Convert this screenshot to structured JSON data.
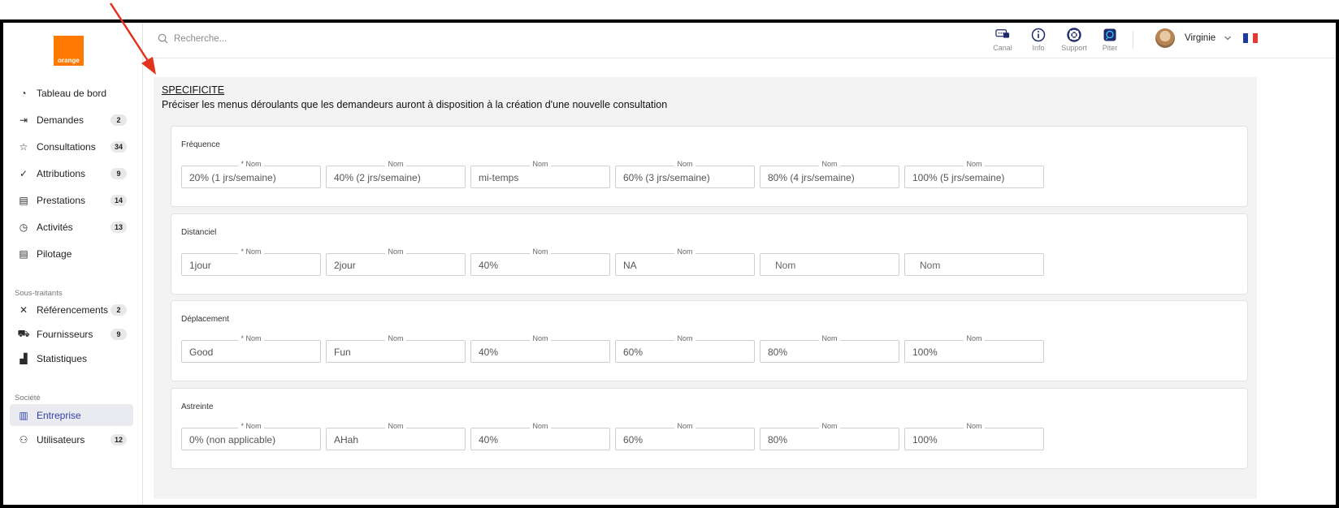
{
  "brand": {
    "logo_text": "orange",
    "color": "#ff7900"
  },
  "search": {
    "placeholder": "Recherche..."
  },
  "toolbar": {
    "items": [
      {
        "label": "Canal",
        "icon": "chat-icon"
      },
      {
        "label": "Info",
        "icon": "info-icon"
      },
      {
        "label": "Support",
        "icon": "lifebuoy-icon"
      },
      {
        "label": "Piter",
        "icon": "assistant-icon"
      }
    ],
    "user_name": "Virginie",
    "language": "FR"
  },
  "sidebar": {
    "main_items": [
      {
        "label": "Tableau de bord",
        "icon": "gauge-icon",
        "badge": ""
      },
      {
        "label": "Demandes",
        "icon": "login-icon",
        "badge": "2"
      },
      {
        "label": "Consultations",
        "icon": "star-icon",
        "badge": "34"
      },
      {
        "label": "Attributions",
        "icon": "double-check-icon",
        "badge": "9"
      },
      {
        "label": "Prestations",
        "icon": "document-gear-icon",
        "badge": "14"
      },
      {
        "label": "Activités",
        "icon": "clock-icon",
        "badge": "13"
      },
      {
        "label": "Pilotage",
        "icon": "document-icon",
        "badge": ""
      }
    ],
    "subcontractors_title": "Sous-traitants",
    "subcontractor_items": [
      {
        "label": "Référencements",
        "icon": "network-icon",
        "badge": "2"
      },
      {
        "label": "Fournisseurs",
        "icon": "truck-icon",
        "badge": "9"
      },
      {
        "label": "Statistiques",
        "icon": "chart-icon",
        "badge": ""
      }
    ],
    "company_title": "Société",
    "company_items": [
      {
        "label": "Entreprise",
        "icon": "building-icon",
        "badge": "",
        "active": true
      },
      {
        "label": "Utilisateurs",
        "icon": "users-icon",
        "badge": "12"
      }
    ]
  },
  "section": {
    "title": "SPECIFICITE",
    "subtitle": "Préciser les menus déroulants que les demandeurs auront à disposition à la création d'une nouvelle consultation"
  },
  "groups": [
    {
      "title": "Fréquence",
      "fields": [
        {
          "label": "* Nom",
          "value": "20% (1 jrs/semaine)"
        },
        {
          "label": "Nom",
          "value": "40% (2 jrs/semaine)"
        },
        {
          "label": "Nom",
          "value": "mi-temps"
        },
        {
          "label": "Nom",
          "value": "60% (3 jrs/semaine)"
        },
        {
          "label": "Nom",
          "value": "80% (4 jrs/semaine)"
        },
        {
          "label": "Nom",
          "value": "100% (5 jrs/semaine)"
        }
      ]
    },
    {
      "title": "Distanciel",
      "fields": [
        {
          "label": "* Nom",
          "value": "1jour"
        },
        {
          "label": "Nom",
          "value": "2jour"
        },
        {
          "label": "Nom",
          "value": "40%"
        },
        {
          "label": "Nom",
          "value": "NA"
        },
        {
          "label": "",
          "value": "",
          "placeholder": "Nom"
        },
        {
          "label": "",
          "value": "",
          "placeholder": "Nom"
        }
      ]
    },
    {
      "title": "Déplacement",
      "fields": [
        {
          "label": "* Nom",
          "value": "Good"
        },
        {
          "label": "Nom",
          "value": "Fun"
        },
        {
          "label": "Nom",
          "value": "40%"
        },
        {
          "label": "Nom",
          "value": "60%"
        },
        {
          "label": "Nom",
          "value": "80%"
        },
        {
          "label": "Nom",
          "value": "100%"
        }
      ]
    },
    {
      "title": "Astreinte",
      "fields": [
        {
          "label": "* Nom",
          "value": "0% (non applicable)"
        },
        {
          "label": "Nom",
          "value": "AHah"
        },
        {
          "label": "Nom",
          "value": "40%"
        },
        {
          "label": "Nom",
          "value": "60%"
        },
        {
          "label": "Nom",
          "value": "80%"
        },
        {
          "label": "Nom",
          "value": "100%"
        }
      ]
    }
  ],
  "colors": {
    "accent": "#3341a5",
    "annotation": "#e2311d",
    "flag": [
      "#1c3b9b",
      "#ffffff",
      "#e43a35"
    ]
  }
}
